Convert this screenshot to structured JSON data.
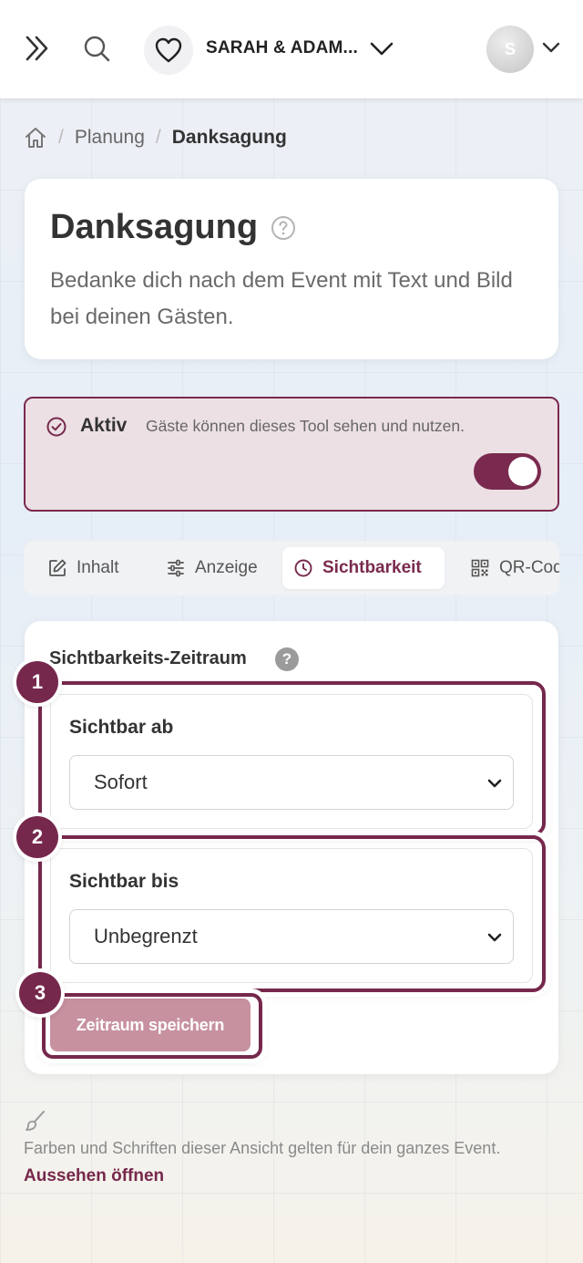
{
  "topbar": {
    "event_name": "SARAH & ADAM...",
    "avatar_initial": "S"
  },
  "breadcrumb": {
    "items": [
      "Planung",
      "Danksagung"
    ]
  },
  "header": {
    "title": "Danksagung",
    "description": "Bedanke dich nach dem Event mit Text und Bild bei deinen Gästen."
  },
  "status": {
    "label": "Aktiv",
    "text": "Gäste können dieses Tool sehen und nutzen.",
    "enabled": true
  },
  "tabs": [
    {
      "label": "Inhalt",
      "icon": "edit-icon",
      "active": false
    },
    {
      "label": "Anzeige",
      "icon": "sliders-icon",
      "active": false
    },
    {
      "label": "Sichtbarkeit",
      "icon": "clock-icon",
      "active": true
    },
    {
      "label": "QR-Code",
      "icon": "qr-code-icon",
      "active": false
    }
  ],
  "visibility": {
    "section_title": "Sichtbarkeits-Zeitraum",
    "help_glyph": "?",
    "from_label": "Sichtbar ab",
    "from_value": "Sofort",
    "until_label": "Sichtbar bis",
    "until_value": "Unbegrenzt",
    "save_label": "Zeitraum speichern"
  },
  "annotations": [
    "1",
    "2",
    "3"
  ],
  "footer": {
    "text": "Farben und Schriften dieser Ansicht gelten für dein ganzes Event.",
    "link": "Aussehen öffnen"
  },
  "colors": {
    "accent": "#76284c",
    "active_bg": "#ece0e4",
    "save_button_bg": "#c7919f"
  }
}
